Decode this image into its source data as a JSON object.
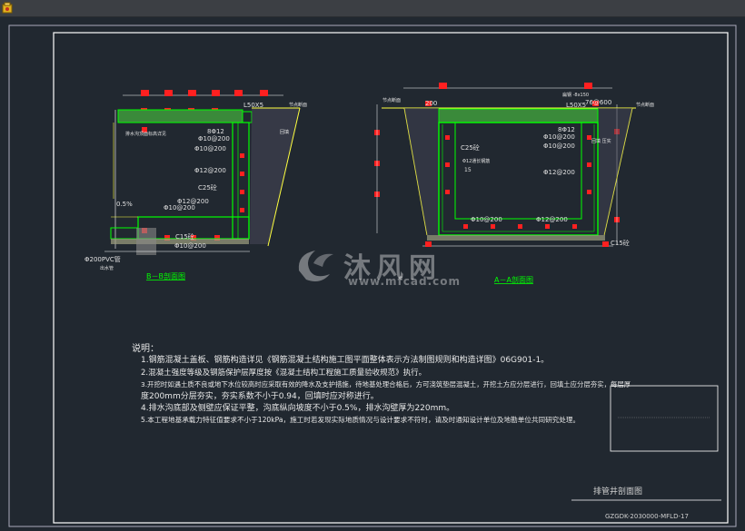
{
  "watermark": {
    "brand": "沐风网",
    "url": "www.mfcad.com"
  },
  "section_bb": {
    "title": "B－B剖面图",
    "labels": {
      "top_right": "节点断面",
      "angle": "L50X5",
      "rebar_top": "8Φ12",
      "r1": "Φ10@200",
      "r2": "Φ10@200",
      "r3": "Φ12@200",
      "concrete": "C25砼",
      "r4": "Φ12@200",
      "r5": "Φ10@200",
      "slope": "0.5%",
      "bottom_conc": "C15砼",
      "r6": "Φ10@200",
      "pipe": "Φ200PVC管",
      "pipe_sub": "出水管",
      "note_left": "排水沟顶面标高详见",
      "note_right": "回填"
    }
  },
  "section_aa": {
    "title": "A－A剖面图",
    "labels": {
      "left_top": "节点断面",
      "dim200": "200",
      "angle": "L50X5",
      "steel": "扁钢 -8x150",
      "grate": "76@600",
      "right_top": "节点断面",
      "rebar_top": "8Φ12",
      "c25": "C25砼",
      "r1": "Φ10@200",
      "r2": "Φ10@200",
      "r3": "Φ12@200",
      "r4": "Φ10@200",
      "r5": "Φ12@200",
      "c15": "C15砼",
      "mid_note": "Φ12通长钢筋",
      "mid_note2": "15",
      "backfill": "回填 压实"
    }
  },
  "notes": {
    "heading": "说明：",
    "items": [
      "1.钢筋混凝土盖板、钢筋构造详见《钢筋混凝土结构施工图平面整体表示方法制图规则和构造详图》06G901-1。",
      "2.混凝土强度等级及钢筋保护层厚度按《混凝土结构工程施工质量验收规范》执行。",
      "3.开挖时如遇土质不良或地下水位较高时应采取有效的降水及支护措施，待地基处理合格后，方可浇筑垫层混凝土，开挖土方应分层进行，回填土应分层夯实，每层厚",
      "度200mm分层夯实，夯实系数不小于0.94，回填时应对称进行。",
      "4.排水沟底部及侧壁应保证平整，沟底纵向坡度不小于0.5%，排水沟壁厚为220mm。",
      "5.本工程地基承载力特征值要求不小于120kPa，施工时若发现实际地质情况与设计要求不符时，请及时通知设计单位及地勘单位共同研究处理。"
    ]
  },
  "title_block": {
    "sheet_title": "排管井剖面图",
    "drawing_no": "GZGDK-2030000-MFLD-17"
  },
  "colors": {
    "background": "#212830",
    "frame": "#ffffff",
    "concrete_outline": "#00ff00",
    "rebar": "#ffff40",
    "dimension": "#ff2020",
    "slab": "#3a8a3a"
  }
}
